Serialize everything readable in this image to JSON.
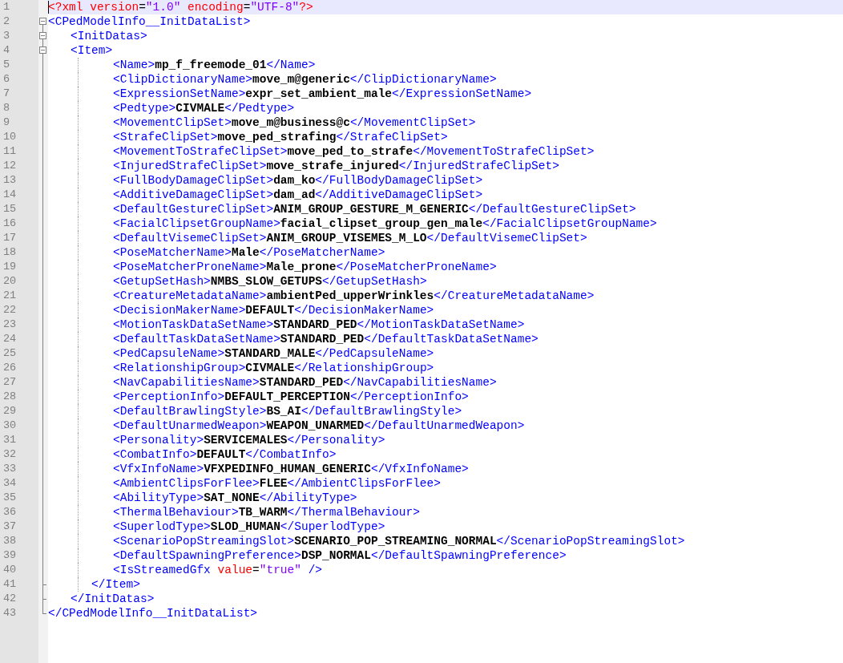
{
  "editor": {
    "lines": [
      {
        "number": "1",
        "current": true,
        "tokens": [
          {
            "kind": "decl",
            "text": "<?xml"
          },
          {
            "kind": "attr",
            "text": " version"
          },
          {
            "kind": "punct",
            "text": "="
          },
          {
            "kind": "string",
            "text": "\"1.0\""
          },
          {
            "kind": "attr",
            "text": " encoding"
          },
          {
            "kind": "punct",
            "text": "="
          },
          {
            "kind": "string",
            "text": "\"UTF-8\""
          },
          {
            "kind": "decl",
            "text": "?>"
          }
        ]
      },
      {
        "number": "2",
        "current": false,
        "open": "<CPedModelInfo__InitDataList>",
        "expanded": true,
        "children": [
          {
            "number": "3",
            "current": false,
            "open": "<InitDatas>",
            "expanded": true,
            "children": [
              {
                "number": "4",
                "current": false,
                "open": "<Item>",
                "expanded": true,
                "children": [
                  {
                    "number": "5",
                    "current": false,
                    "open": "<Name>",
                    "value": "mp_f_freemode_01",
                    "close": "</Name>"
                  },
                  {
                    "number": "6",
                    "current": false,
                    "open": "<ClipDictionaryName>",
                    "value": "move_m@generic",
                    "close": "</ClipDictionaryName>"
                  },
                  {
                    "number": "7",
                    "current": false,
                    "open": "<ExpressionSetName>",
                    "value": "expr_set_ambient_male",
                    "close": "</ExpressionSetName>"
                  },
                  {
                    "number": "8",
                    "current": false,
                    "open": "<Pedtype>",
                    "value": "CIVMALE",
                    "close": "</Pedtype>"
                  },
                  {
                    "number": "9",
                    "current": false,
                    "open": "<MovementClipSet>",
                    "value": "move_m@business@c",
                    "close": "</MovementClipSet>"
                  },
                  {
                    "number": "10",
                    "current": false,
                    "open": "<StrafeClipSet>",
                    "value": "move_ped_strafing",
                    "close": "</StrafeClipSet>"
                  },
                  {
                    "number": "11",
                    "current": false,
                    "open": "<MovementToStrafeClipSet>",
                    "value": "move_ped_to_strafe",
                    "close": "</MovementToStrafeClipSet>"
                  },
                  {
                    "number": "12",
                    "current": false,
                    "open": "<InjuredStrafeClipSet>",
                    "value": "move_strafe_injured",
                    "close": "</InjuredStrafeClipSet>"
                  },
                  {
                    "number": "13",
                    "current": false,
                    "open": "<FullBodyDamageClipSet>",
                    "value": "dam_ko",
                    "close": "</FullBodyDamageClipSet>"
                  },
                  {
                    "number": "14",
                    "current": false,
                    "open": "<AdditiveDamageClipSet>",
                    "value": "dam_ad",
                    "close": "</AdditiveDamageClipSet>"
                  },
                  {
                    "number": "15",
                    "current": false,
                    "open": "<DefaultGestureClipSet>",
                    "value": "ANIM_GROUP_GESTURE_M_GENERIC",
                    "close": "</DefaultGestureClipSet>"
                  },
                  {
                    "number": "16",
                    "current": false,
                    "open": "<FacialClipsetGroupName>",
                    "value": "facial_clipset_group_gen_male",
                    "close": "</FacialClipsetGroupName>"
                  },
                  {
                    "number": "17",
                    "current": false,
                    "open": "<DefaultVisemeClipSet>",
                    "value": "ANIM_GROUP_VISEMES_M_LO",
                    "close": "</DefaultVisemeClipSet>"
                  },
                  {
                    "number": "18",
                    "current": false,
                    "open": "<PoseMatcherName>",
                    "value": "Male",
                    "close": "</PoseMatcherName>"
                  },
                  {
                    "number": "19",
                    "current": false,
                    "open": "<PoseMatcherProneName>",
                    "value": "Male_prone",
                    "close": "</PoseMatcherProneName>"
                  },
                  {
                    "number": "20",
                    "current": false,
                    "open": "<GetupSetHash>",
                    "value": "NMBS_SLOW_GETUPS",
                    "close": "</GetupSetHash>"
                  },
                  {
                    "number": "21",
                    "current": false,
                    "open": "<CreatureMetadataName>",
                    "value": "ambientPed_upperWrinkles",
                    "close": "</CreatureMetadataName>"
                  },
                  {
                    "number": "22",
                    "current": false,
                    "open": "<DecisionMakerName>",
                    "value": "DEFAULT",
                    "close": "</DecisionMakerName>"
                  },
                  {
                    "number": "23",
                    "current": false,
                    "open": "<MotionTaskDataSetName>",
                    "value": "STANDARD_PED",
                    "close": "</MotionTaskDataSetName>"
                  },
                  {
                    "number": "24",
                    "current": false,
                    "open": "<DefaultTaskDataSetName>",
                    "value": "STANDARD_PED",
                    "close": "</DefaultTaskDataSetName>"
                  },
                  {
                    "number": "25",
                    "current": false,
                    "open": "<PedCapsuleName>",
                    "value": "STANDARD_MALE",
                    "close": "</PedCapsuleName>"
                  },
                  {
                    "number": "26",
                    "current": false,
                    "open": "<RelationshipGroup>",
                    "value": "CIVMALE",
                    "close": "</RelationshipGroup>"
                  },
                  {
                    "number": "27",
                    "current": false,
                    "open": "<NavCapabilitiesName>",
                    "value": "STANDARD_PED",
                    "close": "</NavCapabilitiesName>"
                  },
                  {
                    "number": "28",
                    "current": false,
                    "open": "<PerceptionInfo>",
                    "value": "DEFAULT_PERCEPTION",
                    "close": "</PerceptionInfo>"
                  },
                  {
                    "number": "29",
                    "current": false,
                    "open": "<DefaultBrawlingStyle>",
                    "value": "BS_AI",
                    "close": "</DefaultBrawlingStyle>"
                  },
                  {
                    "number": "30",
                    "current": false,
                    "open": "<DefaultUnarmedWeapon>",
                    "value": "WEAPON_UNARMED",
                    "close": "</DefaultUnarmedWeapon>"
                  },
                  {
                    "number": "31",
                    "current": false,
                    "open": "<Personality>",
                    "value": "SERVICEMALES",
                    "close": "</Personality>"
                  },
                  {
                    "number": "32",
                    "current": false,
                    "open": "<CombatInfo>",
                    "value": "DEFAULT",
                    "close": "</CombatInfo>"
                  },
                  {
                    "number": "33",
                    "current": false,
                    "open": "<VfxInfoName>",
                    "value": "VFXPEDINFO_HUMAN_GENERIC",
                    "close": "</VfxInfoName>"
                  },
                  {
                    "number": "34",
                    "current": false,
                    "open": "<AmbientClipsForFlee>",
                    "value": "FLEE",
                    "close": "</AmbientClipsForFlee>"
                  },
                  {
                    "number": "35",
                    "current": false,
                    "open": "<AbilityType>",
                    "value": "SAT_NONE",
                    "close": "</AbilityType>"
                  },
                  {
                    "number": "36",
                    "current": false,
                    "open": "<ThermalBehaviour>",
                    "value": "TB_WARM",
                    "close": "</ThermalBehaviour>"
                  },
                  {
                    "number": "37",
                    "current": false,
                    "open": "<SuperlodType>",
                    "value": "SLOD_HUMAN",
                    "close": "</SuperlodType>"
                  },
                  {
                    "number": "38",
                    "current": false,
                    "open": "<ScenarioPopStreamingSlot>",
                    "value": "SCENARIO_POP_STREAMING_NORMAL",
                    "close": "</ScenarioPopStreamingSlot>"
                  },
                  {
                    "number": "39",
                    "current": false,
                    "open": "<DefaultSpawningPreference>",
                    "value": "DSP_NORMAL",
                    "close": "</DefaultSpawningPreference>"
                  },
                  {
                    "number": "40",
                    "current": false,
                    "tokens": [
                      {
                        "kind": "tag",
                        "text": "<IsStreamedGfx"
                      },
                      {
                        "kind": "attr",
                        "text": " value"
                      },
                      {
                        "kind": "punct",
                        "text": "="
                      },
                      {
                        "kind": "string",
                        "text": "\"true\""
                      },
                      {
                        "kind": "tag",
                        "text": " />"
                      }
                    ]
                  }
                ]
              },
              {
                "number": "41",
                "current": false,
                "close": "</Item>"
              }
            ]
          },
          {
            "number": "42",
            "current": false,
            "close": "</InitDatas>"
          }
        ]
      },
      {
        "number": "43",
        "current": false,
        "close": "</CPedModelInfo__InitDataList>"
      }
    ]
  }
}
